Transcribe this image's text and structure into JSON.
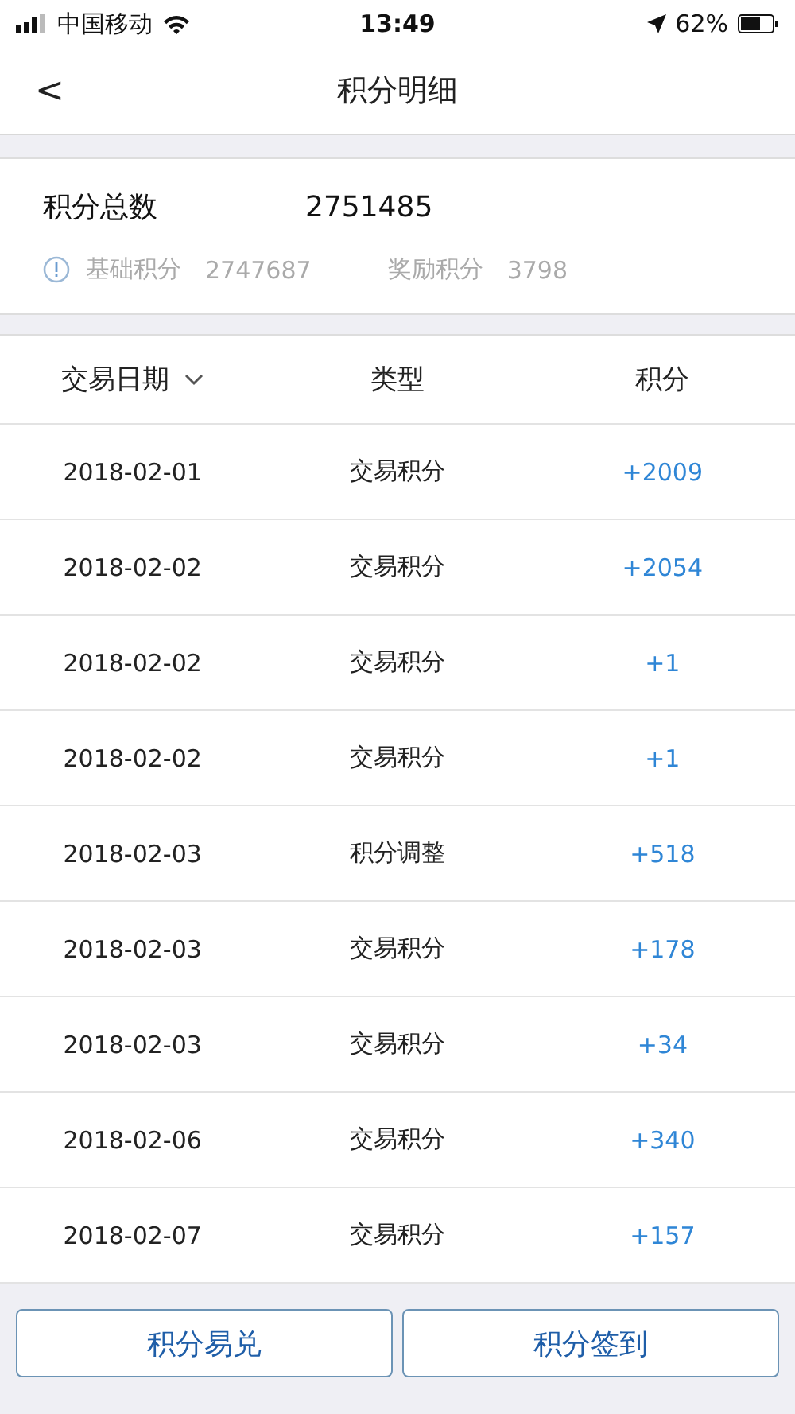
{
  "status_bar": {
    "carrier": "中国移动",
    "time": "13:49",
    "battery": "62%"
  },
  "nav": {
    "back": "<",
    "title": "积分明细"
  },
  "summary": {
    "total_label": "积分总数",
    "total": "2751485",
    "base_label": "基础积分",
    "base": "2747687",
    "bonus_label": "奖励积分",
    "bonus": "3798"
  },
  "table": {
    "columns": [
      "交易日期",
      "类型",
      "积分"
    ],
    "rows": [
      {
        "date": "2018-02-01",
        "type": "交易积分",
        "points": "+2009"
      },
      {
        "date": "2018-02-02",
        "type": "交易积分",
        "points": "+2054"
      },
      {
        "date": "2018-02-02",
        "type": "交易积分",
        "points": "+1"
      },
      {
        "date": "2018-02-02",
        "type": "交易积分",
        "points": "+1"
      },
      {
        "date": "2018-02-03",
        "type": "积分调整",
        "points": "+518"
      },
      {
        "date": "2018-02-03",
        "type": "交易积分",
        "points": "+178"
      },
      {
        "date": "2018-02-03",
        "type": "交易积分",
        "points": "+34"
      },
      {
        "date": "2018-02-06",
        "type": "交易积分",
        "points": "+340"
      },
      {
        "date": "2018-02-07",
        "type": "交易积分",
        "points": "+157"
      }
    ]
  },
  "buttons": [
    "积分易兑",
    "积分签到"
  ]
}
